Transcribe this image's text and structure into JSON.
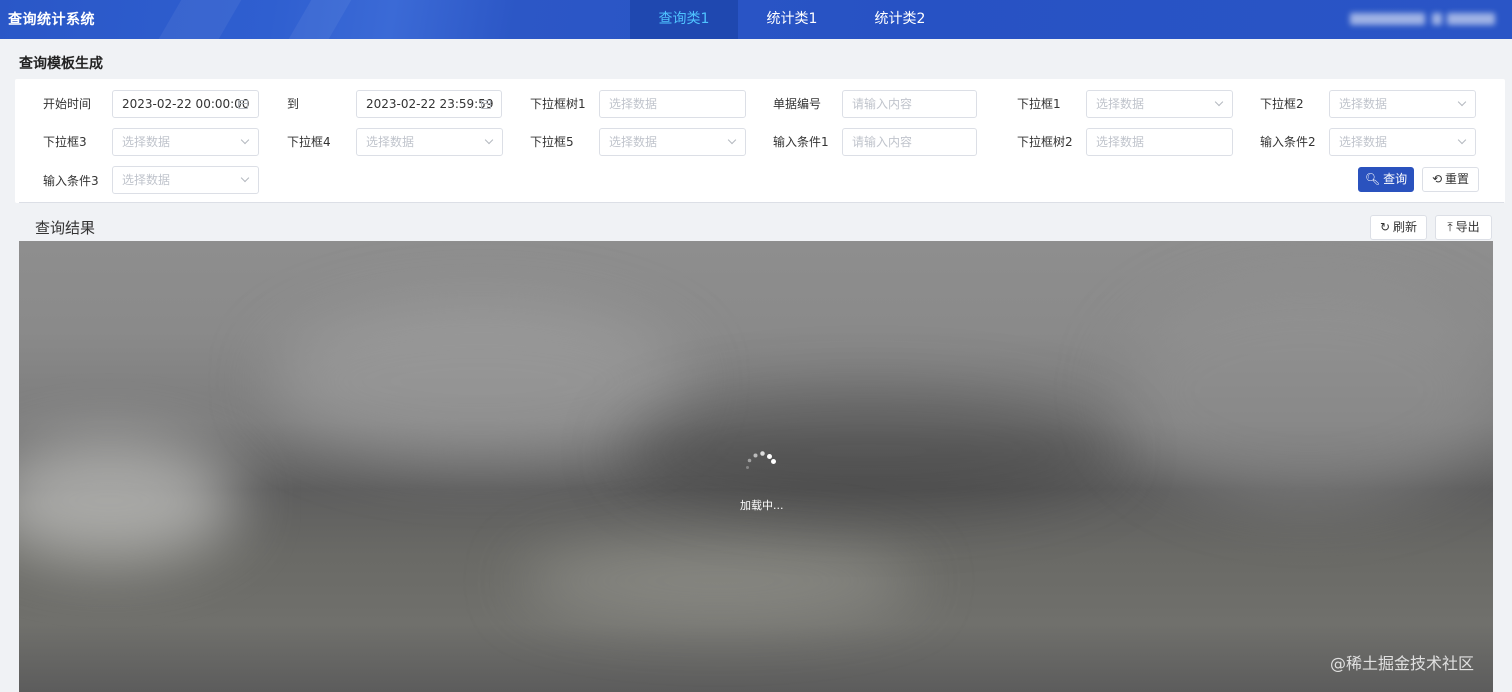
{
  "app": {
    "title": "查询统计系统"
  },
  "nav": {
    "tabs": [
      {
        "label": "查询类1",
        "active": true
      },
      {
        "label": "统计类1",
        "active": false
      },
      {
        "label": "统计类2",
        "active": false
      }
    ]
  },
  "section_title": "查询模板生成",
  "form": {
    "row1": {
      "start_time": {
        "label": "开始时间",
        "value": "2023-02-22 00:00:00"
      },
      "to": {
        "label": "到",
        "value": "2023-02-22 23:59:59"
      },
      "tree1": {
        "label": "下拉框树1",
        "placeholder": "选择数据"
      },
      "doc_no": {
        "label": "单据编号",
        "placeholder": "请输入内容"
      },
      "dropdown1": {
        "label": "下拉框1",
        "placeholder": "选择数据"
      },
      "dropdown2": {
        "label": "下拉框2",
        "placeholder": "选择数据"
      }
    },
    "row2": {
      "dropdown3": {
        "label": "下拉框3",
        "placeholder": "选择数据"
      },
      "dropdown4": {
        "label": "下拉框4",
        "placeholder": "选择数据"
      },
      "dropdown5": {
        "label": "下拉框5",
        "placeholder": "选择数据"
      },
      "cond1": {
        "label": "输入条件1",
        "placeholder": "请输入内容"
      },
      "tree2": {
        "label": "下拉框树2",
        "placeholder": "选择数据"
      },
      "cond2": {
        "label": "输入条件2",
        "placeholder": "选择数据"
      }
    },
    "row3": {
      "cond3": {
        "label": "输入条件3",
        "placeholder": "选择数据"
      }
    },
    "search_label": "查询",
    "reset_label": "重置"
  },
  "results": {
    "title": "查询结果",
    "refresh_label": "刷新",
    "export_label": "导出",
    "loading_text": "加载中..."
  },
  "watermark": "@稀土掘金技术社区"
}
